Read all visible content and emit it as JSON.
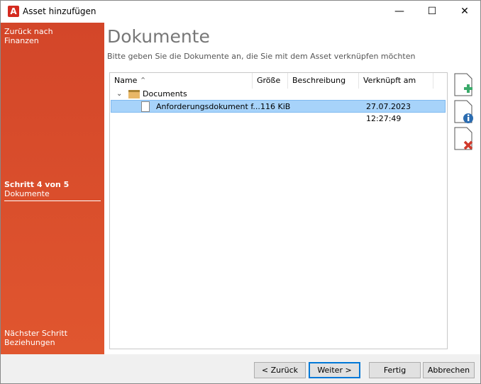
{
  "window": {
    "title": "Asset hinzufügen",
    "app_icon_letter": "A"
  },
  "sidebar": {
    "back": "Zurück nach Finanzen",
    "back_line1": "Zurück nach",
    "back_line2": "Finanzen",
    "step": "Schritt 4 von 5",
    "step_name": "Dokumente",
    "next_label": "Nächster Schritt",
    "next_name": "Beziehungen"
  },
  "main": {
    "title": "Dokumente",
    "subtitle": "Bitte geben Sie die Dokumente an, die Sie mit dem Asset verknüpfen möchten"
  },
  "list": {
    "columns": [
      "Name",
      "Größe",
      "Beschreibung",
      "Verknüpft am"
    ],
    "sort_indicator": "^",
    "folder": "Documents",
    "rows": [
      {
        "name": "Anforderungsdokument f...",
        "size": "116 KiB",
        "description": "",
        "linked": "27.07.2023 12:27:49",
        "selected": true
      }
    ]
  },
  "buttons": {
    "back": "< Zurück",
    "next": "Weiter >",
    "finish": "Fertig",
    "cancel": "Abbrechen"
  },
  "colors": {
    "sidebar": "#d8492c",
    "selection": "#a7d3fa",
    "default_button_border": "#0078d7"
  }
}
